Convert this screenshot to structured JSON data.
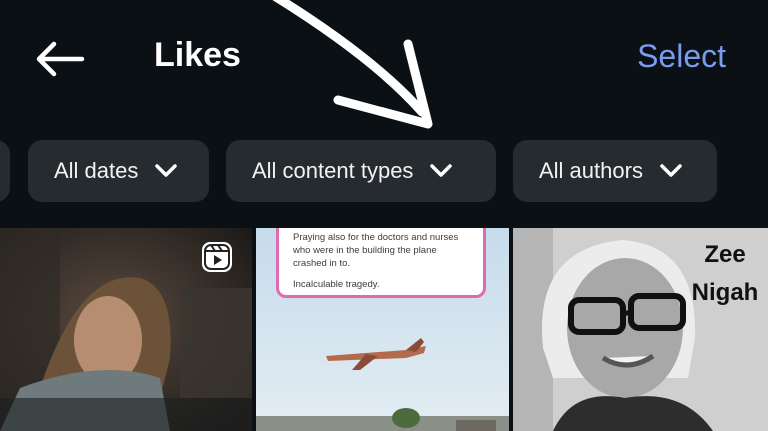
{
  "header": {
    "title": "Likes",
    "select_label": "Select"
  },
  "filters": [
    {
      "label": "All dates"
    },
    {
      "label": "All content types"
    },
    {
      "label": "All authors"
    }
  ],
  "grid": {
    "tile_2": {
      "quote_line_1": "Praying also for the doctors and nurses who were in the building the plane crashed in to.",
      "quote_line_2": "Incalculable tragedy."
    },
    "tile_3": {
      "logo_line_1": "Zee",
      "logo_line_2": "Nigah"
    }
  },
  "colors": {
    "background": "#0b1014",
    "accent_link": "#7b9bf0",
    "chip_background": "#262b30",
    "quote_border": "#e06ab0"
  },
  "icons": {
    "back": "arrow-left-icon",
    "chevron": "chevron-down-icon",
    "reel": "reels-icon"
  }
}
